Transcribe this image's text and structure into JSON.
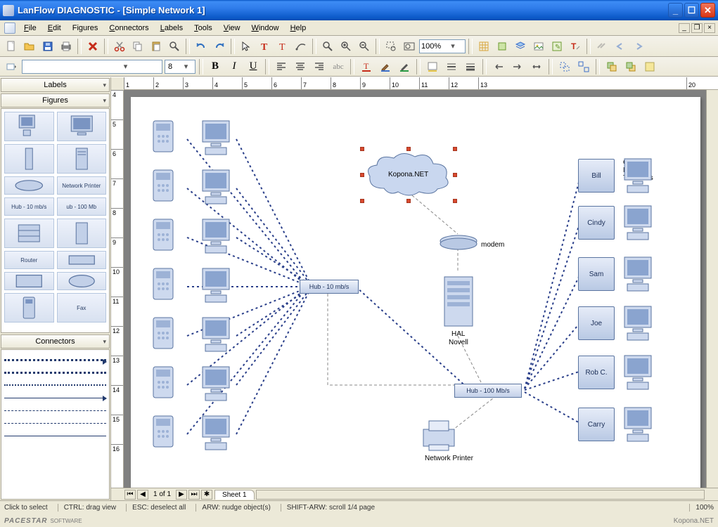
{
  "title": "LanFlow DIAGNOSTIC - [Simple Network 1]",
  "menu": [
    "File",
    "Edit",
    "Figures",
    "Connectors",
    "Labels",
    "Tools",
    "View",
    "Window",
    "Help"
  ],
  "zoom": "100%",
  "font_size": "8",
  "style_combo": "",
  "side_panels": {
    "labels": "Labels",
    "figures": "Figures",
    "connectors": "Connectors"
  },
  "figure_items": [
    {
      "label": ""
    },
    {
      "label": ""
    },
    {
      "label": ""
    },
    {
      "label": ""
    },
    {
      "label": ""
    },
    {
      "label": "Network Printer"
    },
    {
      "label": "Hub - 10 mb/s"
    },
    {
      "label": "ub - 100 Mb"
    },
    {
      "label": ""
    },
    {
      "label": ""
    },
    {
      "label": "Router"
    },
    {
      "label": ""
    },
    {
      "label": ""
    },
    {
      "label": ""
    },
    {
      "label": ""
    },
    {
      "label": "Fax"
    }
  ],
  "ruler_h": [
    "1",
    "2",
    "3",
    "4",
    "5",
    "6",
    "7",
    "8",
    "9",
    "10",
    "11",
    "12",
    "13",
    "20"
  ],
  "ruler_v": [
    "4",
    "5",
    "6",
    "7",
    "8",
    "9",
    "10",
    "11",
    "12",
    "13",
    "14",
    "15",
    "16"
  ],
  "diagram": {
    "cloud_label": "Kopona.NET",
    "modem_label": "modem",
    "server_label1": "HAL",
    "server_label2": "Novell",
    "hub1": "Hub - 10 mb/s",
    "hub2": "Hub - 100 Mb/s",
    "printer_label": "Network Printer",
    "section_label": "Order\nEntry\nTerminals",
    "terminals": [
      "Bill",
      "Cindy",
      "Sam",
      "Joe",
      "Rob C.",
      "Carry"
    ]
  },
  "sheet": {
    "page_info": "1 of 1",
    "tab": "Sheet 1"
  },
  "status": {
    "s1": "Click to select",
    "s2": "CTRL: drag view",
    "s3": "ESC: deselect all",
    "s4": "ARW: nudge object(s)",
    "s5": "SHIFT-ARW: scroll 1/4 page",
    "zoom": "100%"
  },
  "brand": "PACESTAR",
  "brand_sub": "SOFTWARE",
  "watermark": "Kopona.NET"
}
